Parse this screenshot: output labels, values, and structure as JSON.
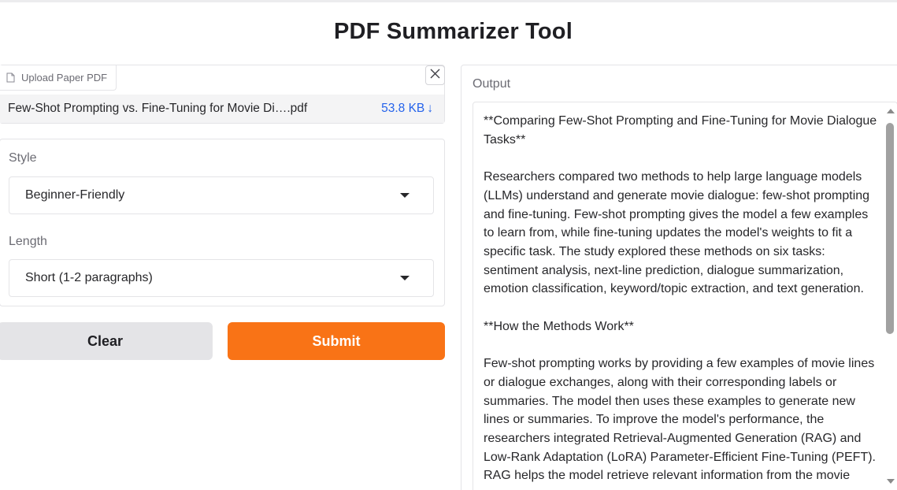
{
  "app": {
    "title": "PDF Summarizer Tool"
  },
  "upload": {
    "label": "Upload Paper PDF",
    "file_name": "Few-Shot Prompting vs. Fine-Tuning for Movie Di….pdf",
    "file_size": "53.8 KB",
    "download_icon": "↓",
    "close_icon": "✕"
  },
  "settings": {
    "style_label": "Style",
    "style_value": "Beginner-Friendly",
    "length_label": "Length",
    "length_value": "Short (1-2 paragraphs)"
  },
  "actions": {
    "clear_label": "Clear",
    "submit_label": "Submit"
  },
  "output": {
    "label": "Output",
    "text": "**Comparing Few-Shot Prompting and Fine-Tuning for Movie Dialogue Tasks**\n\nResearchers compared two methods to help large language models (LLMs) understand and generate movie dialogue: few-shot prompting and fine-tuning. Few-shot prompting gives the model a few examples to learn from, while fine-tuning updates the model's weights to fit a specific task. The study explored these methods on six tasks: sentiment analysis, next-line prediction, dialogue summarization, emotion classification, keyword/topic extraction, and text generation.\n\n**How the Methods Work**\n\nFew-shot prompting works by providing a few examples of movie lines or dialogue exchanges, along with their corresponding labels or summaries. The model then uses these examples to generate new lines or summaries. To improve the model's performance, the researchers integrated Retrieval-Augmented Generation (RAG) and Low-Rank Adaptation (LoRA) Parameter-Efficient Fine-Tuning (PEFT). RAG helps the model retrieve relevant information from the movie"
  },
  "colors": {
    "accent": "#f97316",
    "link": "#2563eb",
    "border": "#e4e4e7",
    "secondary_button": "#e4e4e7"
  },
  "icons": {
    "file": "file-icon",
    "close": "close-icon",
    "download": "download-arrow-icon",
    "dropdown": "chevron-down-icon"
  }
}
